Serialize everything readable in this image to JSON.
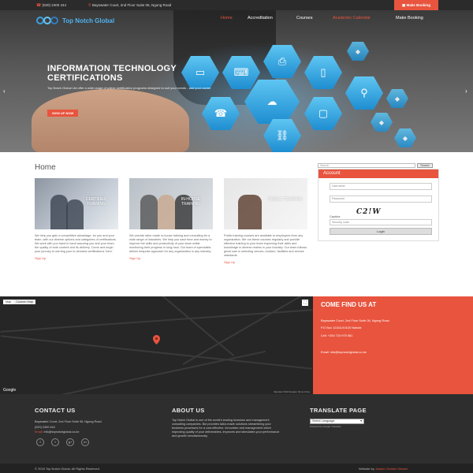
{
  "topbar": {
    "phone": "(020) 2400 444",
    "address": "Bayswater Court, 2nd Floor Suite 06, Ngong Road",
    "make_booking": "Make Booking"
  },
  "logo": {
    "text": "Top Notch Global"
  },
  "nav": [
    {
      "label": "Home",
      "active": true
    },
    {
      "label": "Accreditation",
      "active": false
    },
    {
      "label": "Courses",
      "active": false
    },
    {
      "label": "Academic Calendar",
      "active": true
    },
    {
      "label": "Make Booking",
      "active": false
    }
  ],
  "hero": {
    "title": "INFORMATION TECHNOLOGY CERTIFICATIONS",
    "subtitle": "Top Notch Global Ltd offer a wide range of online certification programs designed to suit your needs - and your career",
    "signup": "SIGN UP NOW",
    "prev_arrow": "‹",
    "next_arrow": "›"
  },
  "main": {
    "title": "Home",
    "cards": [
      {
        "overlay": "CERTIFIED TRAINING",
        "text": "We help you gain a competitive advantage, for you and your team, with our diverse options and categories of certifications. We work with you hand in hand assuring you and your team the quality of both content and its delivery. Come and begin your journey to earning your in-demand certifications 'here'.",
        "signup": "Sign Up"
      },
      {
        "overlay": "IN-HOUSE TRAINING",
        "text": "We provide tailor made in-house training and consulting for a wide range of industries. We help you save time and money to improve the skills and productivity of your team whilst monitoring their progress in long-haul. Our team of specialists deliver bespoke approach for any organization in any industry.",
        "signup": "Sign Up"
      },
      {
        "overlay": "PUBLIC TRAINING",
        "text": "Public training courses are available to employees from any organization. We run these courses regularly and provide effective training to your team improving their skills and knowledge in diverse realms in your industry. Our team follows great care in selecting venues, location, facilities and service standards.",
        "signup": "Sign Up"
      }
    ]
  },
  "sidebar": {
    "search_placeholder": "Search",
    "search_button": "Search",
    "account_title": "Account",
    "username_placeholder": "Username",
    "password_placeholder": "Password",
    "captcha_label": "Captcha",
    "captcha_text": "C2!W",
    "security_placeholder": "Security code",
    "login": "Login"
  },
  "map": {
    "tab_map": "Map",
    "tab_satellite": "Custom Map",
    "google": "Google",
    "attribution": "Map data ©2016 Google | Terms of Use"
  },
  "find_us": {
    "title": "COME FIND US AT",
    "address": "Bayswater Court, 2nd Floor Suite 06, Ngong Road",
    "po_box": "P.O Box 12163-00100 Nairobi",
    "cell": "Cell: +254 724 975 581",
    "email": "Email: info@topnotchglobal.co.ke"
  },
  "footer": {
    "contact_title": "CONTACT US",
    "contact_address": "Bayswater Court, 2nd Floor Suite 06, Ngong Road",
    "contact_phone": "(020) 2400 444",
    "email_label": "Email:",
    "email_value": "info@topnotchglobal.co.ke",
    "social": [
      "f",
      "t",
      "g+",
      "in"
    ],
    "about_title": "ABOUT US",
    "about_text": "Top Notch Global is one of the world's leading business and management consulting companies. But provides tailor-made solutions streamlining your business processes for a cost-effective, innovative and management which improving quality of your deliverables, improves and stimulates your performance and growth simultaneously.",
    "translate_title": "TRANSLATE PAGE",
    "language_select": "Select Language",
    "powered_by": "Powered by Google Translate"
  },
  "bottombar": {
    "copyright": "© 2016 Top Notch Global. All Rights Reserved",
    "website_by": "Website by",
    "designer": "Joseph Godwin Kimani"
  },
  "colors": {
    "accent": "#e8543e",
    "dark": "#2e2e2e",
    "hex_blue": "#1e8ed1"
  }
}
